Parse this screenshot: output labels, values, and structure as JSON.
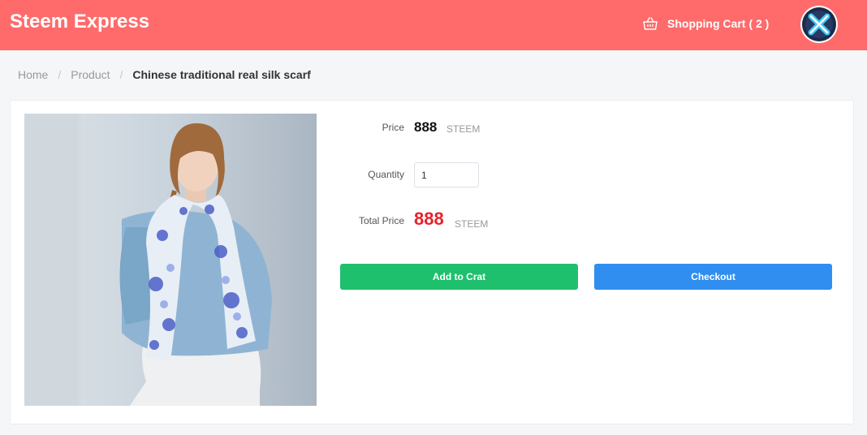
{
  "header": {
    "brand": "Steem Express",
    "cart_label": "Shopping Cart",
    "cart_count": "( 2 )",
    "cart_icon": "basket-icon",
    "avatar_icon": "steem-x-logo",
    "bg_color": "#ff6b6b"
  },
  "breadcrumb": {
    "items": [
      "Home",
      "Product"
    ],
    "separator": "/",
    "current": "Chinese traditional real silk scarf"
  },
  "product": {
    "price_label": "Price",
    "price": "888",
    "currency": "STEEM",
    "quantity_label": "Quantity",
    "quantity": "1",
    "total_label": "Total Price",
    "total": "888",
    "total_color": "#e8212b"
  },
  "actions": {
    "add_label": "Add to Crat",
    "add_color": "#1fc06d",
    "checkout_label": "Checkout",
    "checkout_color": "#2f8ef0"
  }
}
